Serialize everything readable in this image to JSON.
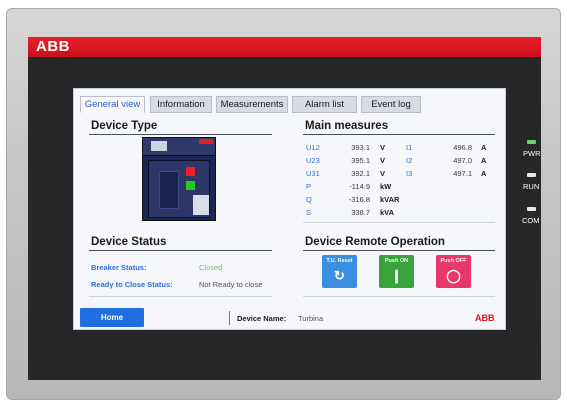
{
  "brand": {
    "logo": "ABB"
  },
  "tabs": [
    {
      "label": "General view",
      "active": true
    },
    {
      "label": "Information",
      "active": false
    },
    {
      "label": "Measurements",
      "active": false
    },
    {
      "label": "Alarm list",
      "active": false
    },
    {
      "label": "Event log",
      "active": false
    }
  ],
  "device_type": {
    "title": "Device Type"
  },
  "main_measures": {
    "title": "Main measures",
    "rows": [
      {
        "label": "U12",
        "value": "393.1",
        "unit": "V",
        "label2": "I1",
        "value2": "496.8",
        "unit2": "A"
      },
      {
        "label": "U23",
        "value": "395.1",
        "unit": "V",
        "label2": "I2",
        "value2": "497.0",
        "unit2": "A"
      },
      {
        "label": "U31",
        "value": "392.1",
        "unit": "V",
        "label2": "I3",
        "value2": "497.1",
        "unit2": "A"
      },
      {
        "label": "P",
        "value": "-114.9",
        "unit": "kW"
      },
      {
        "label": "Q",
        "value": "-316.8",
        "unit": "kVAR"
      },
      {
        "label": "S",
        "value": "338.7",
        "unit": "kVA"
      }
    ]
  },
  "device_status": {
    "title": "Device Status",
    "breaker_label": "Breaker Status:",
    "breaker_value": "Closed",
    "ready_label": "Ready to Close Status:",
    "ready_value": "Not Ready to close"
  },
  "remote_operation": {
    "title": "Device Remote Operation",
    "buttons": [
      {
        "label": "T.U. Reset",
        "color": "#3b8fe0"
      },
      {
        "label": "Push ON",
        "color": "#37a33a"
      },
      {
        "label": "Push OFF",
        "color": "#e8376a"
      }
    ]
  },
  "footer": {
    "home_label": "Home",
    "device_name_label": "Device Name:",
    "device_name_value": "Turbina",
    "logo": "ABB"
  },
  "leds": [
    {
      "label": "PWR",
      "color": "#6fd36f"
    },
    {
      "label": "RUN",
      "color": "#e8e8e8"
    },
    {
      "label": "COM",
      "color": "#e8e8e8"
    }
  ],
  "colors": {
    "accent_blue": "#2f6fd6",
    "brand_red": "#d7121d",
    "closed_green": "#6cbf6c"
  }
}
